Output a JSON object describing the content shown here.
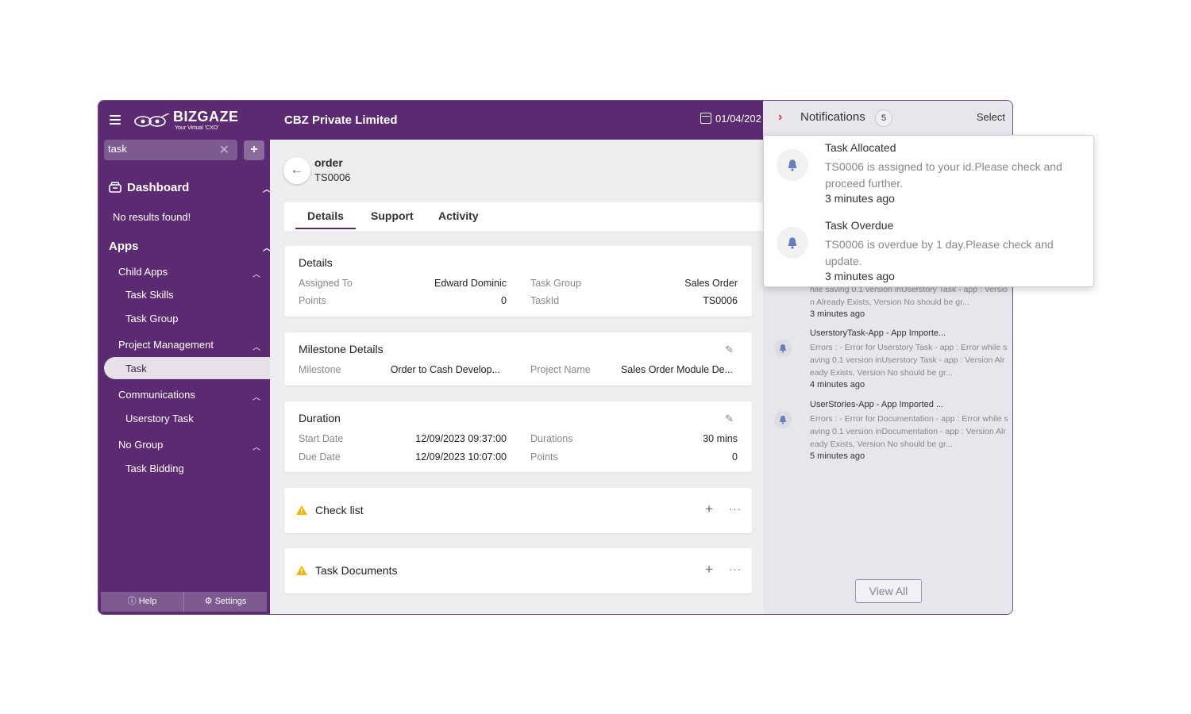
{
  "sidebar": {
    "logo_text": "BIZGAZE",
    "logo_tagline": "Your Virtual 'CXO'",
    "search_value": "task",
    "dashboard_label": "Dashboard",
    "no_results": "No results found!",
    "apps_label": "Apps",
    "groups": [
      {
        "label": "Child Apps",
        "items": [
          "Task Skills",
          "Task Group"
        ]
      },
      {
        "label": "Project Management",
        "items": [
          "Task"
        ]
      },
      {
        "label": "Communications",
        "items": [
          "Userstory Task"
        ]
      },
      {
        "label": "No Group",
        "items": [
          "Task Bidding"
        ]
      }
    ],
    "active_item": "Task",
    "help_label": "Help",
    "settings_label": "Settings"
  },
  "header": {
    "company": "CBZ Private Limited",
    "date": "01/04/202"
  },
  "page": {
    "title": "order",
    "subtitle": "TS0006",
    "tabs": [
      "Details",
      "Support",
      "Activity"
    ],
    "active_tab": "Details"
  },
  "details": {
    "title": "Details",
    "assigned_to_label": "Assigned To",
    "assigned_to": "Edward Dominic",
    "task_group_label": "Task Group",
    "task_group": "Sales Order",
    "points_label": "Points",
    "points": "0",
    "taskid_label": "TaskId",
    "taskid": "TS0006"
  },
  "milestone": {
    "title": "Milestone Details",
    "milestone_label": "Milestone",
    "milestone": "Order to Cash Develop...",
    "project_label": "Project Name",
    "project": "Sales Order Module De..."
  },
  "duration": {
    "title": "Duration",
    "start_label": "Start Date",
    "start": "12/09/2023 09:37:00",
    "durations_label": "Durations",
    "durations": "30 mins",
    "due_label": "Due Date",
    "due": "12/09/2023 10:07:00",
    "points_label": "Points",
    "points": "0"
  },
  "checklist": {
    "title": "Check list"
  },
  "documents": {
    "title": "Task Documents"
  },
  "notifications": {
    "title": "Notifications",
    "count": "5",
    "select_label": "Select",
    "partial_body": "hile saving 0.1 version inUserstory Task - app : Version Already Exists, Version No should be gr...",
    "partial_time": "3 minutes ago",
    "items": [
      {
        "title": "UserstoryTask-App - App Importe...",
        "body": "Errors : - Error for Userstory Task - app : Error while saving 0.1 version inUserstory Task - app : Version Already Exists, Version No should be gr...",
        "time": "4 minutes ago"
      },
      {
        "title": "UserStories-App - App Imported ...",
        "body": "Errors : - Error for Documentation - app : Error while saving 0.1 version inDocumentation - app : Version Already Exists, Version No should be gr...",
        "time": "5 minutes ago"
      }
    ],
    "view_all": "View All"
  },
  "popup": {
    "items": [
      {
        "title": "Task Allocated",
        "body": "TS0006 is assigned to your id.Please check and proceed further.",
        "time": "3 minutes ago"
      },
      {
        "title": "Task Overdue",
        "body": "TS0006 is overdue by 1 day.Please check and update.",
        "time": "3 minutes ago"
      }
    ]
  },
  "colors": {
    "brand": "#5b2a70",
    "alert": "#e53935",
    "warning": "#f5b400"
  },
  "icons": [
    "menu-icon",
    "calendar-icon",
    "back-arrow-icon",
    "pencil-icon",
    "warning-icon",
    "plus-icon",
    "more-icon",
    "chevron-right-icon",
    "bell-icon",
    "help-icon",
    "gear-icon",
    "dashboard-icon"
  ]
}
